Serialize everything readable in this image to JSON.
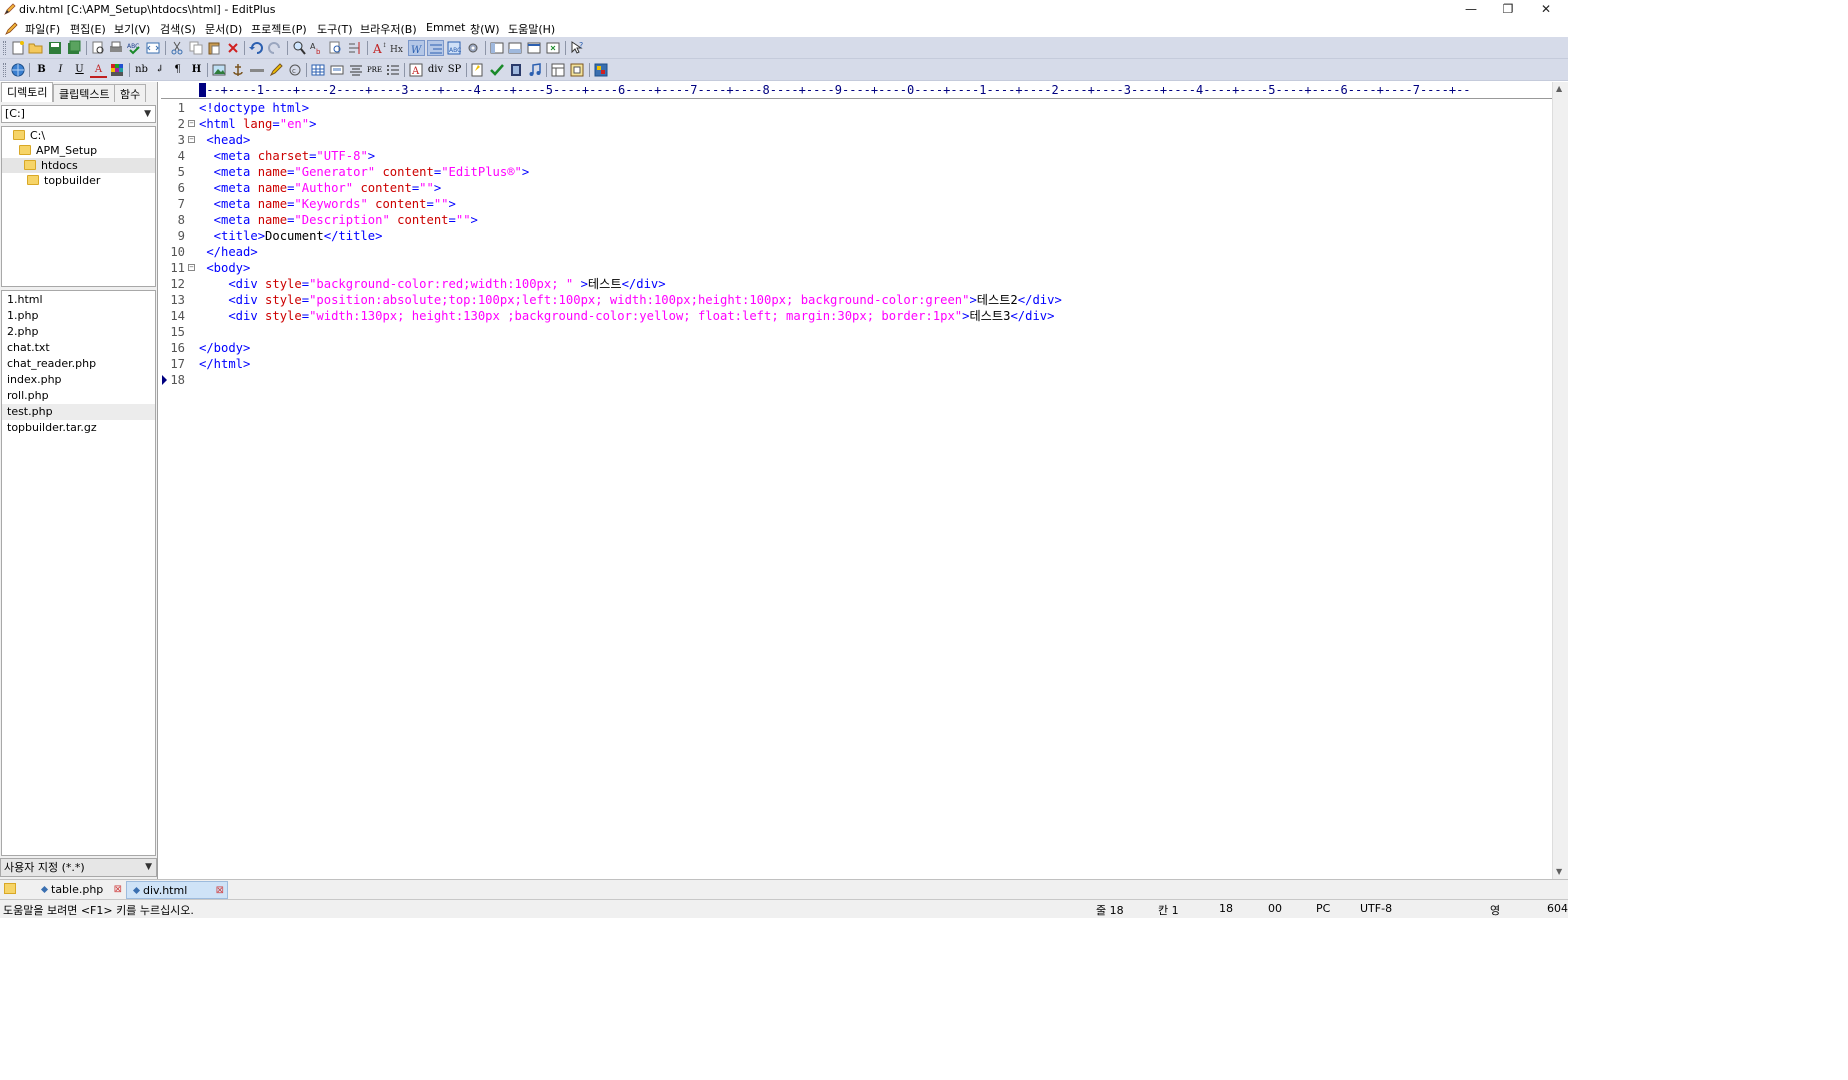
{
  "window": {
    "title": "div.html [C:\\APM_Setup\\htdocs\\html] - EditPlus",
    "minimize": "—",
    "restore": "❐",
    "close": "✕"
  },
  "menu": [
    "파일(F)",
    "편집(E)",
    "보기(V)",
    "검색(S)",
    "문서(D)",
    "프로젝트(P)",
    "도구(T)",
    "브라우저(B)",
    "Emmet",
    "창(W)",
    "도움말(H)"
  ],
  "mdi_controls": {
    "minimize": "–",
    "restore": "🗗",
    "close": "✕"
  },
  "toolbar2_text": {
    "bold": "B",
    "italic": "I",
    "underline": "U",
    "font_color": "A",
    "nbsp": "nb",
    "br": "↲",
    "para": "¶",
    "heading": "H",
    "pre": "PRE",
    "div": "div",
    "span": "SP"
  },
  "sidebar": {
    "tabs": [
      "디렉토리",
      "클립텍스트",
      "함수"
    ],
    "drive": "[C:]",
    "tree": [
      "C:\\",
      "APM_Setup",
      "htdocs",
      "topbuilder"
    ],
    "files": [
      "1.html",
      "1.php",
      "2.php",
      "chat.txt",
      "chat_reader.php",
      "index.php",
      "roll.php",
      "test.php",
      "topbuilder.tar.gz"
    ],
    "filter": "사용자 지정 (*.*)"
  },
  "ruler": "---+----1----+----2----+----3----+----4----+----5----+----6----+----7----+----8----+----9----+----0----+----1----+----2----+----3----+----4----+----5----+----6----+----7----+--",
  "code": {
    "line_numbers": [
      "1",
      "2",
      "3",
      "4",
      "5",
      "6",
      "7",
      "8",
      "9",
      "10",
      "11",
      "12",
      "13",
      "14",
      "15",
      "16",
      "17",
      "18"
    ],
    "l1": [
      "<!doctype html>"
    ],
    "l2": [
      "<html ",
      "lang",
      "=",
      "\"en\"",
      ">"
    ],
    "l3": [
      " <head>"
    ],
    "l4": [
      "  <meta ",
      "charset",
      "=",
      "\"UTF-8\"",
      ">"
    ],
    "l5": [
      "  <meta ",
      "name",
      "=",
      "\"Generator\"",
      " ",
      "content",
      "=",
      "\"EditPlus®\"",
      ">"
    ],
    "l6": [
      "  <meta ",
      "name",
      "=",
      "\"Author\"",
      " ",
      "content",
      "=",
      "\"\"",
      ">"
    ],
    "l7": [
      "  <meta ",
      "name",
      "=",
      "\"Keywords\"",
      " ",
      "content",
      "=",
      "\"\"",
      ">"
    ],
    "l8": [
      "  <meta ",
      "name",
      "=",
      "\"Description\"",
      " ",
      "content",
      "=",
      "\"\"",
      ">"
    ],
    "l9": [
      "  <title>",
      "Document",
      "</title>"
    ],
    "l10": [
      " </head>"
    ],
    "l11": [
      " <body>"
    ],
    "l12": [
      "    <div ",
      "style",
      "=",
      "\"background-color:red;width:100px; \"",
      " >",
      "테스트",
      "</div>"
    ],
    "l13": [
      "    <div ",
      "style",
      "=",
      "\"position:absolute;top:100px;left:100px; width:100px;height:100px; background-color:green\"",
      ">",
      "테스트2",
      "</div>"
    ],
    "l14": [
      "    <div ",
      "style",
      "=",
      "\"width:130px; height:130px ;background-color:yellow; float:left; margin:30px; border:1px\"",
      ">",
      "테스트3",
      "</div>"
    ],
    "l16": [
      "</body>"
    ],
    "l17": [
      "</html>"
    ]
  },
  "doc_tabs": [
    {
      "label": "table.php",
      "close": "⊠"
    },
    {
      "label": "div.html",
      "close": "⊠"
    }
  ],
  "status": {
    "help": "도움말을 보려면 <F1> 키를 누르십시오.",
    "line": "줄 18",
    "col": "칸 1",
    "lines_total": "18",
    "code": "00",
    "mode": "PC",
    "encoding": "UTF-8",
    "ime": "영",
    "bytes": "604"
  },
  "colors": {
    "tag": "#0000ff",
    "attr": "#cc0000",
    "value": "#ff00ff",
    "toolbar": "#d6dbe9",
    "ruler": "#000080"
  }
}
